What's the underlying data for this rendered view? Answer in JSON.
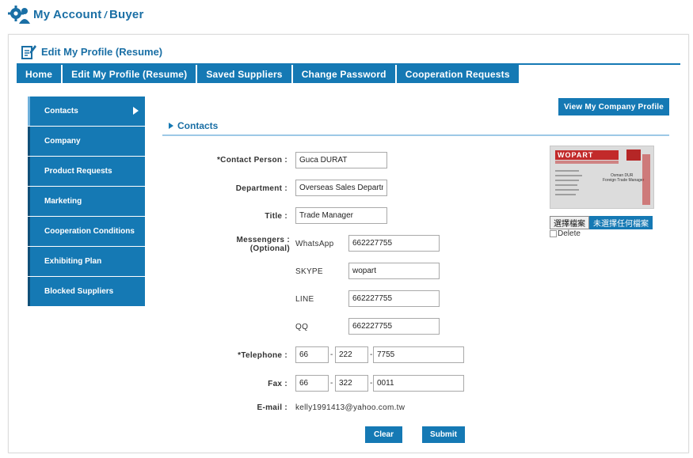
{
  "header": {
    "title_main": "My Account",
    "title_sep": "/",
    "title_sub": "Buyer",
    "icon": "gear-person-icon"
  },
  "panel": {
    "title": "Edit My Profile (Resume)",
    "icon": "edit-document-icon"
  },
  "tabs": [
    {
      "label": "Home"
    },
    {
      "label": "Edit My Profile (Resume)"
    },
    {
      "label": "Saved Suppliers"
    },
    {
      "label": "Change Password"
    },
    {
      "label": "Cooperation Requests"
    }
  ],
  "sidebar": {
    "items": [
      {
        "label": "Contacts",
        "active": true
      },
      {
        "label": "Company"
      },
      {
        "label": "Product Requests"
      },
      {
        "label": "Marketing"
      },
      {
        "label": "Cooperation Conditions"
      },
      {
        "label": "Exhibiting Plan"
      },
      {
        "label": "Blocked Suppliers"
      }
    ]
  },
  "view_profile_label": "View My Company Profile",
  "section_title": "Contacts",
  "form": {
    "contact_person": {
      "label": "*Contact Person :",
      "value": "Guca DURAT"
    },
    "department": {
      "label": "Department :",
      "value": "Overseas Sales Department"
    },
    "title": {
      "label": "Title :",
      "value": "Trade Manager"
    },
    "messengers": {
      "label_1": "Messengers :",
      "label_2": "(Optional)",
      "items": [
        {
          "name": "WhatsApp",
          "value": "662227755"
        },
        {
          "name": "SKYPE",
          "value": "wopart"
        },
        {
          "name": "LINE",
          "value": "662227755"
        },
        {
          "name": "QQ",
          "value": "662227755"
        }
      ]
    },
    "telephone": {
      "label": "*Telephone :",
      "country": "66",
      "area": "222",
      "number": "7755"
    },
    "fax": {
      "label": "Fax :",
      "country": "66",
      "area": "322",
      "number": "0011"
    },
    "email": {
      "label": "E-mail :",
      "value": "kelly1991413@yahoo.com.tw"
    },
    "dash": "-"
  },
  "card": {
    "logo_text": "WOPART",
    "name_line": "Osman DUR",
    "role_line": "Foreign Trade Manager"
  },
  "file": {
    "button": "選擇檔案",
    "status": "未選擇任何檔案",
    "delete_label": "Delete"
  },
  "buttons": {
    "clear": "Clear",
    "submit": "Submit"
  },
  "colors": {
    "brand": "#1579b4",
    "title": "#1a6fa5"
  }
}
